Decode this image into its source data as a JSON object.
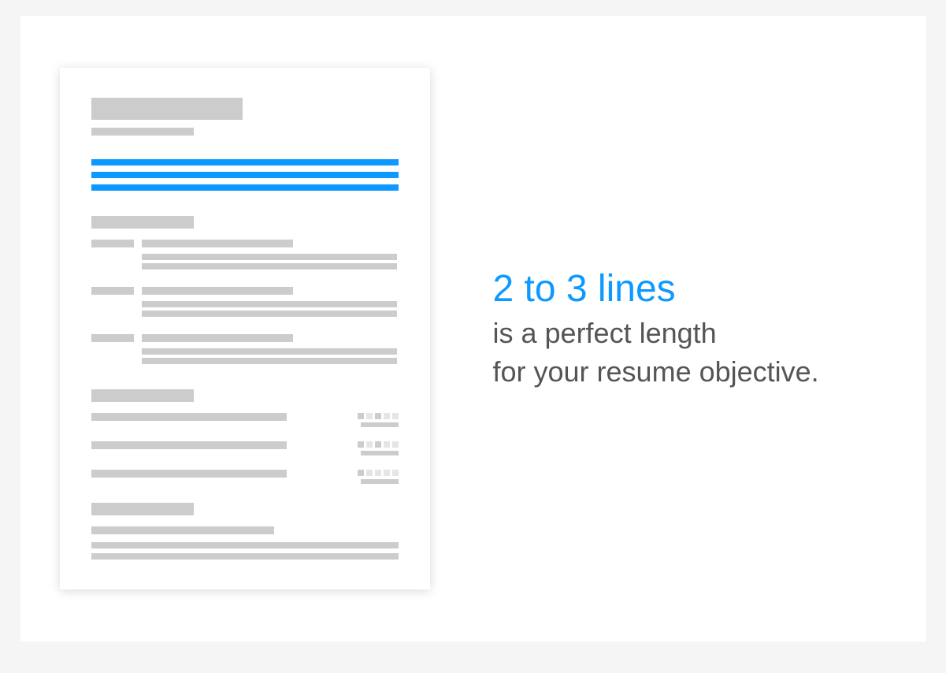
{
  "message": {
    "headline": "2 to 3 lines",
    "line1": "is a perfect length",
    "line2": "for your resume objective."
  },
  "colors": {
    "accent": "#0d99ff",
    "placeholder": "#cccccc"
  }
}
